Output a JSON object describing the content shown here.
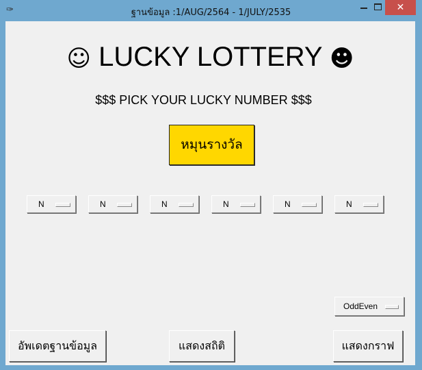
{
  "window": {
    "title": "ฐานข้อมูล  :1/AUG/2564  -  1/JULY/2535",
    "icon": "feather-icon",
    "controls": {
      "minimize": "",
      "maximize": "",
      "close": "✕"
    }
  },
  "header": {
    "left_face": "☺",
    "title": "LUCKY LOTTERY",
    "right_face": "☻",
    "subtitle": "$$$ PICK YOUR LUCKY NUMBER $$$"
  },
  "spin_button": {
    "label": "หมุนรางวัล",
    "color": "#ffd700"
  },
  "digit_dropdowns": [
    {
      "value": "N"
    },
    {
      "value": "N"
    },
    {
      "value": "N"
    },
    {
      "value": "N"
    },
    {
      "value": "N"
    },
    {
      "value": "N"
    }
  ],
  "mode_dropdown": {
    "value": "OddEven"
  },
  "bottom_buttons": {
    "update": "อัพเดตฐานข้อมูล",
    "stats": "แสดงสถิติ",
    "graph": "แสดงกราฟ"
  },
  "colors": {
    "titlebar": "#6fa8cf",
    "close": "#c7504b",
    "background": "#f0f0f0"
  }
}
